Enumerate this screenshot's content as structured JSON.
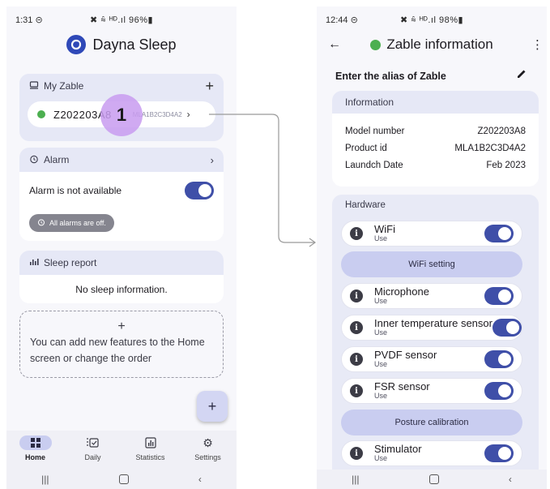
{
  "left": {
    "status": {
      "time": "1:31",
      "time_icon": "⊝",
      "icons": "✖ ⩯ ᴴᴰ.ıl 96%▮"
    },
    "app_title": "Dayna Sleep",
    "my_zable": {
      "title": "My Zable",
      "device_name": "Z202203A8",
      "device_id": "MLA1B2C3D4A2",
      "status_color": "#4caf50"
    },
    "callout_number": "1",
    "alarm": {
      "title": "Alarm",
      "status_text": "Alarm is not available",
      "chip": "All alarms are off."
    },
    "sleep_report": {
      "title": "Sleep report",
      "empty_text": "No sleep information."
    },
    "add_features": {
      "plus": "+",
      "text": "You can add new features to the Home screen or change the order"
    },
    "fab": "+",
    "nav": [
      {
        "label": "Home",
        "icon": "grid-icon"
      },
      {
        "label": "Daily",
        "icon": "daily-icon"
      },
      {
        "label": "Statistics",
        "icon": "statistics-icon"
      },
      {
        "label": "Settings",
        "icon": "settings-icon"
      }
    ]
  },
  "right": {
    "status": {
      "time": "12:44",
      "time_icon": "⊝",
      "icons": "✖ ⩯ ᴴᴰ.ıl 98%▮"
    },
    "back": "←",
    "title": "Zable information",
    "more": "⋮",
    "alias_label": "Enter the alias of Zable",
    "information": {
      "header": "Information",
      "rows": [
        {
          "label": "Model number",
          "value": "Z202203A8"
        },
        {
          "label": "Product id",
          "value": "MLA1B2C3D4A2"
        },
        {
          "label": "Laundch Date",
          "value": "Feb 2023"
        }
      ]
    },
    "hardware": {
      "header": "Hardware",
      "wifi": {
        "name": "WiFi",
        "sub": "Use"
      },
      "wifi_setting": "WiFi setting",
      "microphone": {
        "name": "Microphone",
        "sub": "Use"
      },
      "inner_temp": {
        "name": "Inner temperature sensor",
        "sub": "Use"
      },
      "pvdf": {
        "name": "PVDF sensor",
        "sub": "Use"
      },
      "fsr": {
        "name": "FSR sensor",
        "sub": "Use"
      },
      "posture": "Posture calibration",
      "stimulator": {
        "name": "Stimulator",
        "sub": "Use"
      }
    }
  },
  "colors": {
    "accent": "#3f4fa8",
    "card_header": "#e6e8f6",
    "online": "#4caf50",
    "callout": "#c89bf0"
  }
}
